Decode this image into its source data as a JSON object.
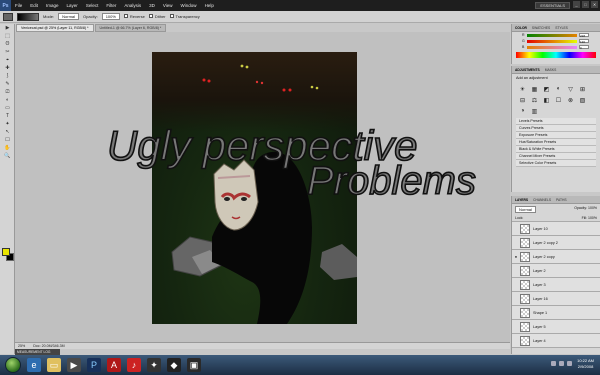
{
  "menubar": {
    "logo": "Ps",
    "items": [
      "File",
      "Edit",
      "Image",
      "Layer",
      "Select",
      "Filter",
      "Analysis",
      "3D",
      "View",
      "Window",
      "Help"
    ],
    "workspace": "ESSENTIALS",
    "window_buttons": [
      "_",
      "□",
      "✕"
    ]
  },
  "options": {
    "mode_label": "Mode:",
    "mode_value": "Normal",
    "opacity_label": "Opacity:",
    "opacity_value": "100%",
    "reverse": "Reverse",
    "dither": "Dither",
    "transparency": "Transparency"
  },
  "tabs": [
    {
      "label": "Venicecat.psd @ 25% (Layer 11, RGB/8) *"
    },
    {
      "label": "Untitled-1 @ 66.7% (Layer 6, RGB/8) *"
    }
  ],
  "tools": [
    "▶",
    "⬚",
    "ʘ",
    "✂",
    "⌖",
    "✚",
    "⟆",
    "✎",
    "⎚",
    "◐",
    "▭",
    "T",
    "✦",
    "↖",
    "☐",
    "✋",
    "🔍"
  ],
  "canvas": {
    "title_line1": "Ugly perspective",
    "title_line2": "Problems"
  },
  "status": {
    "zoom": "25%",
    "doc": "Doc: 20.0M/346.3M",
    "measurement": "MEASUREMENT LOG"
  },
  "color_panel": {
    "tabs": [
      "COLOR",
      "SWATCHES",
      "STYLES"
    ],
    "r": "228",
    "g": "130",
    "b": "0",
    "labels": [
      "R",
      "G",
      "B"
    ]
  },
  "adjustments": {
    "tabs": [
      "ADJUSTMENTS",
      "MASKS"
    ],
    "title": "Add an adjustment",
    "icons": [
      "☀",
      "▦",
      "◩",
      "◐",
      "▽",
      "⊞",
      "⊟",
      "⚖",
      "◧",
      "☐",
      "⊗",
      "▧",
      "◑",
      "▥"
    ],
    "presets": [
      "Levels Presets",
      "Curves Presets",
      "Exposure Presets",
      "Hue/Saturation Presets",
      "Black & White Presets",
      "Channel Mixer Presets",
      "Selective Color Presets"
    ]
  },
  "layers": {
    "tabs": [
      "LAYERS",
      "CHANNELS",
      "PATHS"
    ],
    "blend": "Normal",
    "opacity": "Opacity: 100%",
    "lock": "Lock:",
    "fill": "Fill: 100%",
    "items": [
      {
        "name": "Layer 10",
        "visible": false,
        "active": false
      },
      {
        "name": "Layer 2 copy 2",
        "visible": false,
        "active": false
      },
      {
        "name": "Layer 2 copy",
        "visible": true,
        "active": false
      },
      {
        "name": "Layer 2",
        "visible": false,
        "active": false
      },
      {
        "name": "Layer 3",
        "visible": false,
        "active": false
      },
      {
        "name": "Layer 16",
        "visible": false,
        "active": false
      },
      {
        "name": "Shape 1",
        "visible": false,
        "active": false
      },
      {
        "name": "Layer 5",
        "visible": false,
        "active": false
      },
      {
        "name": "Layer 4",
        "visible": false,
        "active": false
      }
    ]
  },
  "taskbar": {
    "time": "10:22 AM",
    "date": "2/9/2008"
  },
  "colors": {
    "fg": "#e8e400",
    "bg": "#000000",
    "accent": "#b6c8e4"
  }
}
